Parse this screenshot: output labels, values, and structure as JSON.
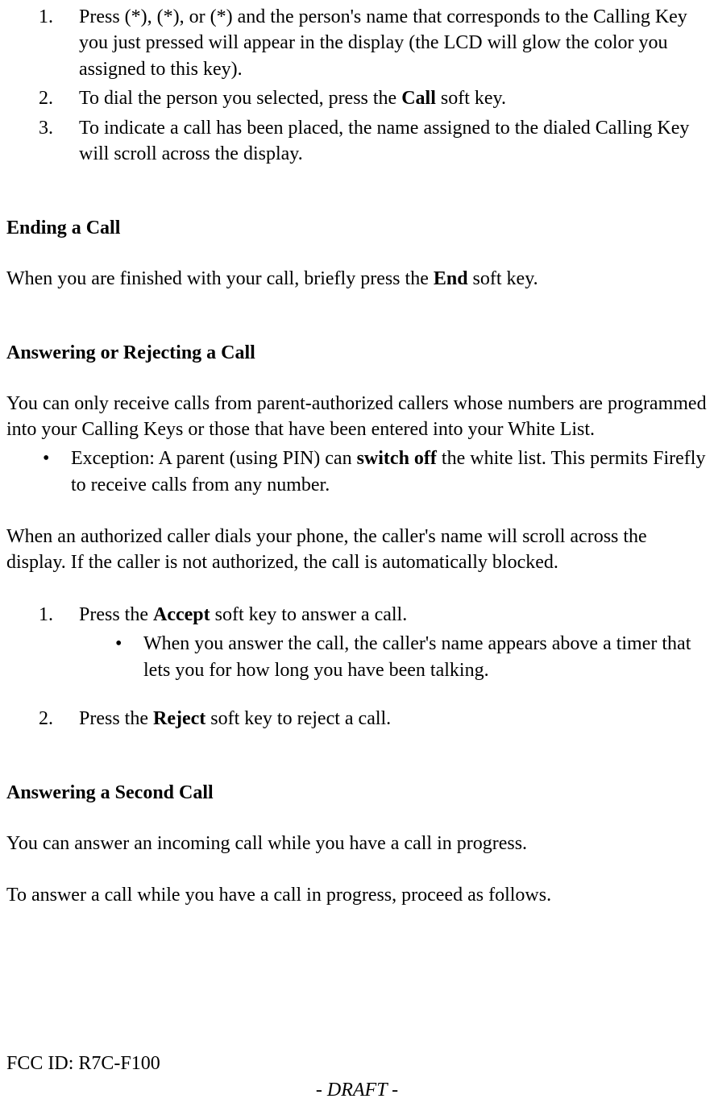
{
  "list1": {
    "item1": {
      "num": "1.",
      "text_before": "Press (*), (*), or (*) and the person's name that corresponds to the Calling Key you just pressed will appear in the display (the LCD will glow the color you assigned to this key)."
    },
    "item2": {
      "num": "2.",
      "text_before": "To dial the person you selected, press the ",
      "bold": "Call",
      "text_after": " soft key."
    },
    "item3": {
      "num": "3.",
      "text_before": "To indicate a call has been placed, the name assigned to the dialed Calling Key will scroll across the display."
    }
  },
  "heading1": "Ending a Call",
  "para1": {
    "before": "When you are finished with your call, briefly press the ",
    "bold": "End",
    "after": " soft key."
  },
  "heading2": "Answering or Rejecting a Call",
  "para2": "You can only receive calls from parent-authorized callers whose numbers are programmed into your Calling Keys or those that have been entered into your White List.",
  "bullet1": {
    "before": "Exception:  A parent (using PIN) can ",
    "bold": "switch off",
    "after": " the white list.  This permits Firefly to receive calls from any number."
  },
  "para3": "When an authorized caller dials your phone, the caller's name will scroll across the display.  If the caller is not authorized, the call is automatically blocked.",
  "list2": {
    "item1": {
      "num": "1.",
      "before": "Press the ",
      "bold": "Accept",
      "after": " soft key to answer a call."
    },
    "nested1": "When you answer the call, the caller's name appears above a timer that lets you for how long you have been talking.",
    "item2": {
      "num": "2.",
      "before": "Press the ",
      "bold": "Reject",
      "after": " soft key to reject a call."
    }
  },
  "heading3": "Answering a Second Call",
  "para4": "You can answer an incoming call while you have a call in progress.",
  "para5": "To answer a call while you have a call in progress, proceed as follows.",
  "footer_id": "FCC ID: R7C-F100",
  "footer_draft": "- DRAFT -",
  "bullet_char": "•"
}
